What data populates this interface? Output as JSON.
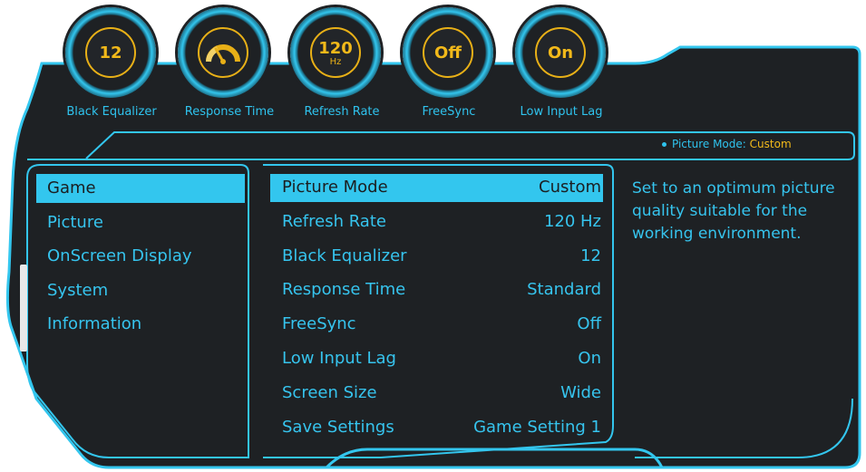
{
  "gauges": [
    {
      "name": "black-equalizer",
      "value": "12",
      "unit": "",
      "label": "Black Equalizer"
    },
    {
      "name": "response-time",
      "value": "",
      "unit": "",
      "label": "Response Time"
    },
    {
      "name": "refresh-rate",
      "value": "120",
      "unit": "Hz",
      "label": "Refresh Rate"
    },
    {
      "name": "freesync",
      "value": "Off",
      "unit": "",
      "label": "FreeSync"
    },
    {
      "name": "low-input-lag",
      "value": "On",
      "unit": "",
      "label": "Low Input Lag"
    }
  ],
  "header": {
    "mode_label": "Picture Mode:",
    "mode_value": "Custom"
  },
  "menu": {
    "items": [
      {
        "label": "Game",
        "selected": true
      },
      {
        "label": "Picture",
        "selected": false
      },
      {
        "label": "OnScreen Display",
        "selected": false
      },
      {
        "label": "System",
        "selected": false
      },
      {
        "label": "Information",
        "selected": false
      }
    ]
  },
  "settings": {
    "rows": [
      {
        "label": "Picture Mode",
        "value": "Custom",
        "selected": true
      },
      {
        "label": "Refresh Rate",
        "value": "120 Hz",
        "selected": false
      },
      {
        "label": "Black Equalizer",
        "value": "12",
        "selected": false
      },
      {
        "label": "Response Time",
        "value": "Standard",
        "selected": false
      },
      {
        "label": "FreeSync",
        "value": "Off",
        "selected": false
      },
      {
        "label": "Low Input Lag",
        "value": "On",
        "selected": false
      },
      {
        "label": "Screen Size",
        "value": "Wide",
        "selected": false
      },
      {
        "label": "Save Settings",
        "value": "Game Setting 1",
        "selected": false
      }
    ]
  },
  "description": {
    "text": "Set to an optimum picture quality suitable for the working environment."
  },
  "colors": {
    "accent": "#33c6ee",
    "highlight_text": "#f2b91a",
    "panel_bg": "#1e2124"
  }
}
